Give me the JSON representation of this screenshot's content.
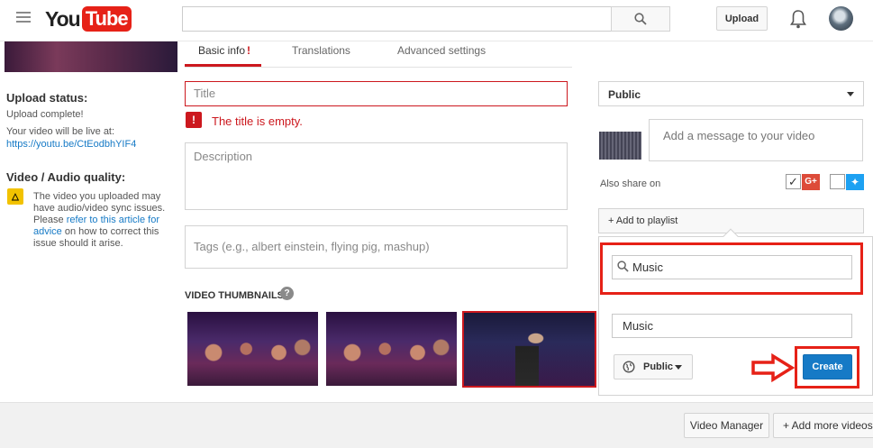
{
  "header": {
    "logo_you": "You",
    "logo_tube": "Tube",
    "search_value": "",
    "upload_label": "Upload"
  },
  "left": {
    "upload_status_heading": "Upload status:",
    "upload_complete": "Upload complete!",
    "live_at": "Your video will be live at:",
    "video_url": "https://youtu.be/CtEodbhYIF4",
    "quality_heading": "Video / Audio quality:",
    "quality_text_1": "The video you uploaded may have audio/video sync issues. Please ",
    "quality_link": "refer to this article for advice",
    "quality_text_2": " on how to correct this issue should it arise."
  },
  "tabs": {
    "basic_info": "Basic info",
    "basic_info_flag": "!",
    "translations": "Translations",
    "advanced": "Advanced settings"
  },
  "form": {
    "title_placeholder": "Title",
    "title_error": "The title is empty.",
    "description_placeholder": "Description",
    "tags_placeholder": "Tags (e.g., albert einstein, flying pig, mashup)",
    "thumbnails_label": "VIDEO THUMBNAILS",
    "selected_thumbnail": 3
  },
  "right": {
    "visibility": "Public",
    "message_placeholder": "Add a message to your video",
    "also_share": "Also share on",
    "google_plus_checked": true,
    "twitter_checked": false,
    "add_to_playlist": "+ Add to playlist",
    "playlist_search": "Music",
    "new_playlist_name": "Music",
    "new_playlist_privacy": "Public",
    "create_label": "Create"
  },
  "footer": {
    "video_manager": "Video Manager",
    "add_more": "+ Add more videos"
  },
  "colors": {
    "brand_red": "#e62117",
    "link_blue": "#167ac6",
    "error_red": "#cc181e"
  }
}
